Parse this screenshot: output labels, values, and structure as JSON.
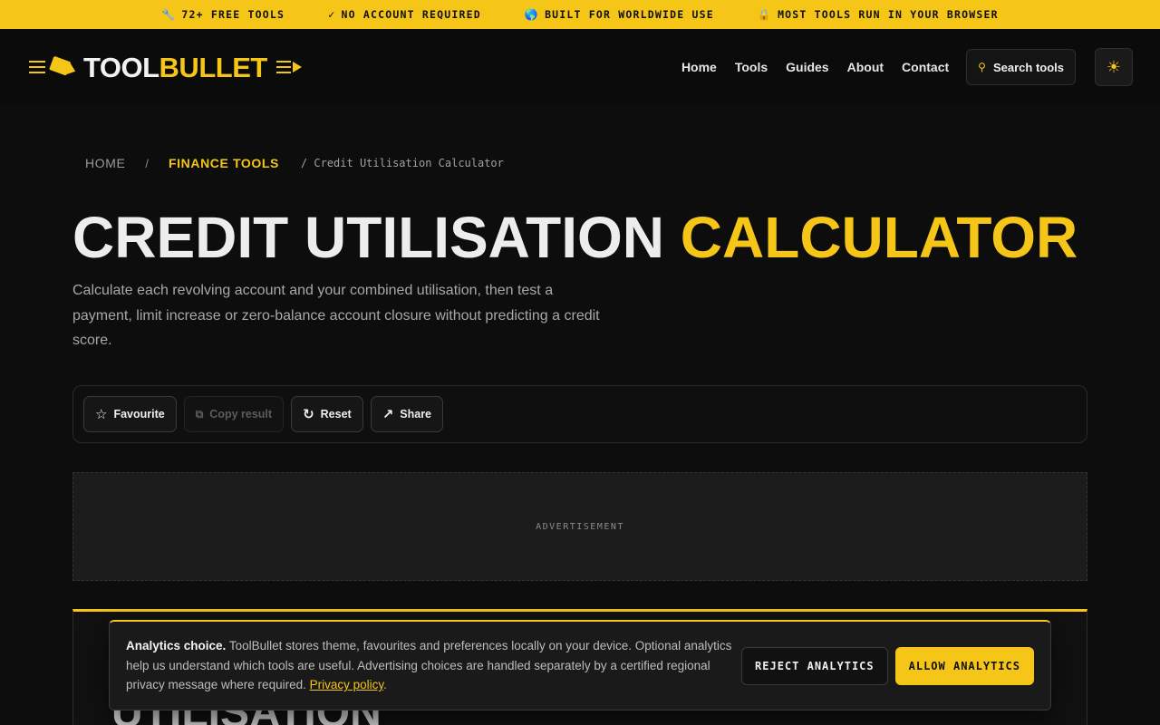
{
  "topstrip": {
    "items": [
      {
        "icon": "wrench-icon",
        "glyph": "🔧",
        "text": "72+ FREE TOOLS"
      },
      {
        "icon": "check-icon",
        "glyph": "✓",
        "text": "NO ACCOUNT REQUIRED"
      },
      {
        "icon": "globe-icon",
        "glyph": "🌎",
        "text": "BUILT FOR WORLDWIDE USE"
      },
      {
        "icon": "lock-icon",
        "glyph": "🔒",
        "text": "MOST TOOLS RUN IN YOUR BROWSER"
      }
    ]
  },
  "header": {
    "logo_part1": "TOOL",
    "logo_part2": "BULLET",
    "nav": [
      "Home",
      "Tools",
      "Guides",
      "About",
      "Contact"
    ],
    "search_label": "Search tools",
    "search_icon": "search-icon",
    "theme_icon": "sun-icon"
  },
  "breadcrumb": {
    "home": "HOME",
    "separator": "/",
    "category": "FINANCE TOOLS",
    "current": "/ Credit Utilisation Calculator"
  },
  "page": {
    "title_part1": "CREDIT UTILISATION",
    "title_part2": "CALCULATOR",
    "subtitle": "Calculate each revolving account and your combined utilisation, then test a payment, limit increase or zero-balance account closure without predicting a credit score."
  },
  "actions": {
    "favourite": "Favourite",
    "copy": "Copy result",
    "reset": "Reset",
    "share": "Share"
  },
  "ad": {
    "label": "ADVERTISEMENT"
  },
  "toolcard": {
    "peek_text": "UTILISATION"
  },
  "consent": {
    "heading": "Analytics choice.",
    "body": "ToolBullet stores theme, favourites and preferences locally on your device. Optional analytics help us understand which tools are useful. Advertising choices are handled separately by a certified regional privacy message where required.",
    "link": "Privacy policy",
    "after_link": ".",
    "reject": "REJECT ANALYTICS",
    "allow": "ALLOW ANALYTICS"
  },
  "colors": {
    "accent": "#f5c518",
    "background": "#0d0d0d",
    "text": "#ececec"
  }
}
